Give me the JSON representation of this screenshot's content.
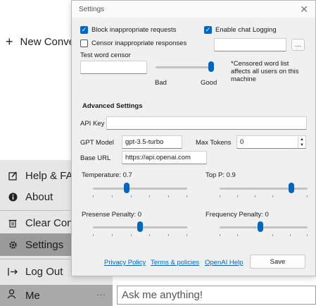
{
  "sidebar": {
    "new_conversation": "New Convers",
    "menu": {
      "help": "Help & FAQ",
      "about": "About",
      "clear": "Clear Conve",
      "settings": "Settings",
      "logout": "Log Out"
    },
    "user": {
      "name": "Me",
      "more": "···"
    }
  },
  "chat": {
    "input_placeholder": "Ask me anything!"
  },
  "dialog": {
    "title": "Settings",
    "block_inappropriate": {
      "label": "Block inappropriate requests",
      "checked": true
    },
    "enable_logging": {
      "label": "Enable chat Logging",
      "checked": true
    },
    "censor_responses": {
      "label": "Censor inappropriate responses",
      "checked": false
    },
    "logging_path_value": "",
    "browse_label": "...",
    "test_word_censor": {
      "label": "Test word censor",
      "value": "",
      "bad_label": "Bad",
      "good_label": "Good",
      "level": 1.0
    },
    "censor_note": "*Censored word list affects all users on this machine",
    "advanced_heading": "Advanced Settings",
    "api_key": {
      "label": "API Key",
      "value": ""
    },
    "gpt_model": {
      "label": "GPT Model",
      "value": "gpt-3.5-turbo"
    },
    "max_tokens": {
      "label": "Max Tokens",
      "value": "0"
    },
    "base_url": {
      "label": "Base URL",
      "value": "https://api.openai.com"
    },
    "temperature": {
      "label": "Temperature: 0.7",
      "value": 0.7
    },
    "top_p": {
      "label": "Top P: 0.9",
      "value": 0.9
    },
    "presence_penalty": {
      "label": "Presense Penalty: 0",
      "value": 0
    },
    "frequency_penalty": {
      "label": "Frequency Penalty: 0",
      "value": 0
    },
    "links": {
      "privacy": "Privacy Policy",
      "terms": "Terms & policies",
      "openai_help": "OpenAI Help"
    },
    "save_label": "Save"
  },
  "colors": {
    "accent": "#0067c0",
    "active_menu": "#9a9a9a",
    "menu_bg": "#e6e6e6"
  }
}
